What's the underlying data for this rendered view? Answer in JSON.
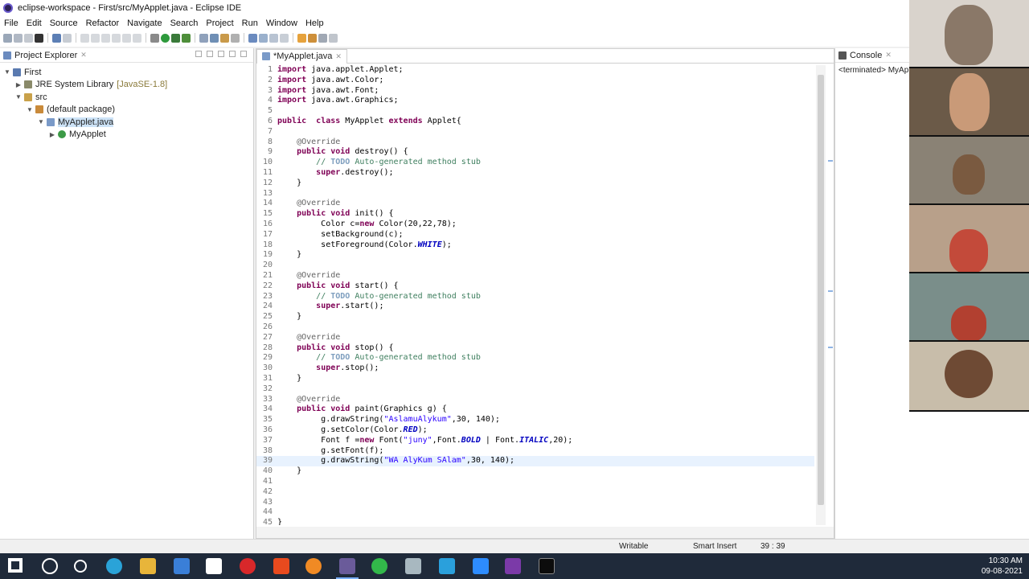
{
  "window": {
    "title": "eclipse-workspace - First/src/MyApplet.java - Eclipse IDE"
  },
  "menu": [
    "File",
    "Edit",
    "Source",
    "Refactor",
    "Navigate",
    "Search",
    "Project",
    "Run",
    "Window",
    "Help"
  ],
  "explorer": {
    "tab_label": "Project Explorer",
    "tree": [
      {
        "label": "First",
        "extra": ""
      },
      {
        "label": "JRE System Library",
        "extra": "[JavaSE-1.8]"
      },
      {
        "label": "src",
        "extra": ""
      },
      {
        "label": "(default package)",
        "extra": ""
      },
      {
        "label": "MyApplet.java",
        "extra": ""
      },
      {
        "label": "MyApplet",
        "extra": ""
      }
    ]
  },
  "editor": {
    "tab_label": "*MyApplet.java",
    "lines": [
      "import java.applet.Applet;",
      "import java.awt.Color;",
      "import java.awt.Font;",
      "import java.awt.Graphics;",
      "",
      "public  class MyApplet extends Applet{",
      "",
      "    @Override",
      "    public void destroy() {",
      "        // TODO Auto-generated method stub",
      "        super.destroy();",
      "    }",
      "",
      "    @Override",
      "    public void init() {",
      "         Color c=new Color(20,22,78);",
      "         setBackground(c);",
      "         setForeground(Color.WHITE);",
      "    }",
      "",
      "    @Override",
      "    public void start() {",
      "        // TODO Auto-generated method stub",
      "        super.start();",
      "    }",
      "",
      "    @Override",
      "    public void stop() {",
      "        // TODO Auto-generated method stub",
      "        super.stop();",
      "    }",
      "",
      "    @Override",
      "    public void paint(Graphics g) {",
      "         g.drawString(\"AslamuAlykum\",30, 140);",
      "         g.setColor(Color.RED);",
      "         Font f =new Font(\"juny\",Font.BOLD | Font.ITALIC,20);",
      "         g.setFont(f);",
      "         g.drawString(\"WA AlyKum SAlam\",30, 140);",
      "    }",
      "",
      "",
      "",
      "",
      "}"
    ]
  },
  "console": {
    "tab_label": "Console",
    "text": "<terminated> MyAp"
  },
  "status": {
    "writable": "Writable",
    "insert_mode": "Smart Insert",
    "position": "39 : 39"
  },
  "taskbar": {
    "time": "10:30 AM",
    "date": "09-08-2021"
  }
}
